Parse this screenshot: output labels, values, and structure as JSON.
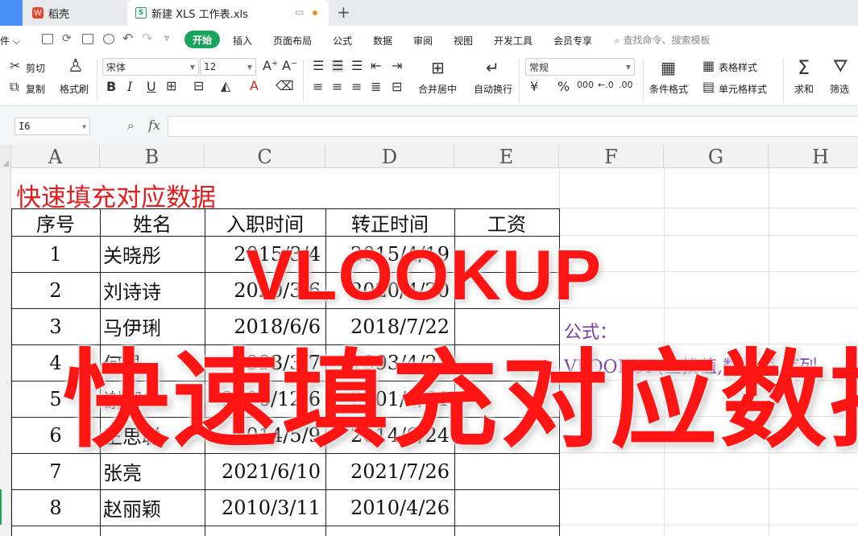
{
  "tabs": {
    "tab1": "稻壳",
    "tab2": "新建 XLS 工作表.xls"
  },
  "menu": {
    "file": "件",
    "items": [
      "开始",
      "插入",
      "页面布局",
      "公式",
      "数据",
      "审阅",
      "视图",
      "开发工具",
      "会员专享"
    ],
    "search": "查找命令、搜索模板"
  },
  "ribbon": {
    "cut": "剪切",
    "copy": "复制",
    "format_painter": "格式刷",
    "font_name": "宋体",
    "font_size": "12",
    "merge": "合并居中",
    "wrap": "自动换行",
    "number_format": "常规",
    "conditional": "条件格式",
    "table_style": "表格样式",
    "cell_style": "单元格样式",
    "sum": "求和",
    "filter": "筛选"
  },
  "formula_bar": {
    "name_box": "I6",
    "fx": "fx"
  },
  "columns": [
    "A",
    "B",
    "C",
    "D",
    "E",
    "F",
    "G",
    "H"
  ],
  "sheet": {
    "title": "快速填充对应数据",
    "headers": [
      "序号",
      "姓名",
      "入职时间",
      "转正时间",
      "工资"
    ],
    "rows": [
      {
        "no": "1",
        "name": "关晓彤",
        "hire": "2015/3/4",
        "regular": "2015/4/19"
      },
      {
        "no": "2",
        "name": "刘诗诗",
        "hire": "2020/3/6",
        "regular": "2020/4/20"
      },
      {
        "no": "3",
        "name": "马伊琍",
        "hire": "2018/6/6",
        "regular": "2018/7/22"
      },
      {
        "no": "4",
        "name": "何炅",
        "hire": "1993/3/7",
        "regular": "1993/4/22"
      },
      {
        "no": "5",
        "name": "谢娜",
        "hire": "2000/12/6",
        "regular": "2001/1/21"
      },
      {
        "no": "6",
        "name": "王思聪",
        "hire": "2014/5/9",
        "regular": "2014/6/24"
      },
      {
        "no": "7",
        "name": "张亮",
        "hire": "2021/6/10",
        "regular": "2021/7/26"
      },
      {
        "no": "8",
        "name": "赵丽颖",
        "hire": "2010/3/11",
        "regular": "2010/4/26"
      }
    ],
    "formula_label": "公式：",
    "formula_text": "VLOOKUP(查找值,数据表,序列"
  },
  "overlay": {
    "big_word": "VLOOKUP",
    "big_title": "快速填充对应数据"
  },
  "colors": {
    "accent_green": "#1aa35b",
    "title_red": "#e21d1d",
    "overlay_red": "#ff1414",
    "formula_purple": "#7a3ea8"
  }
}
